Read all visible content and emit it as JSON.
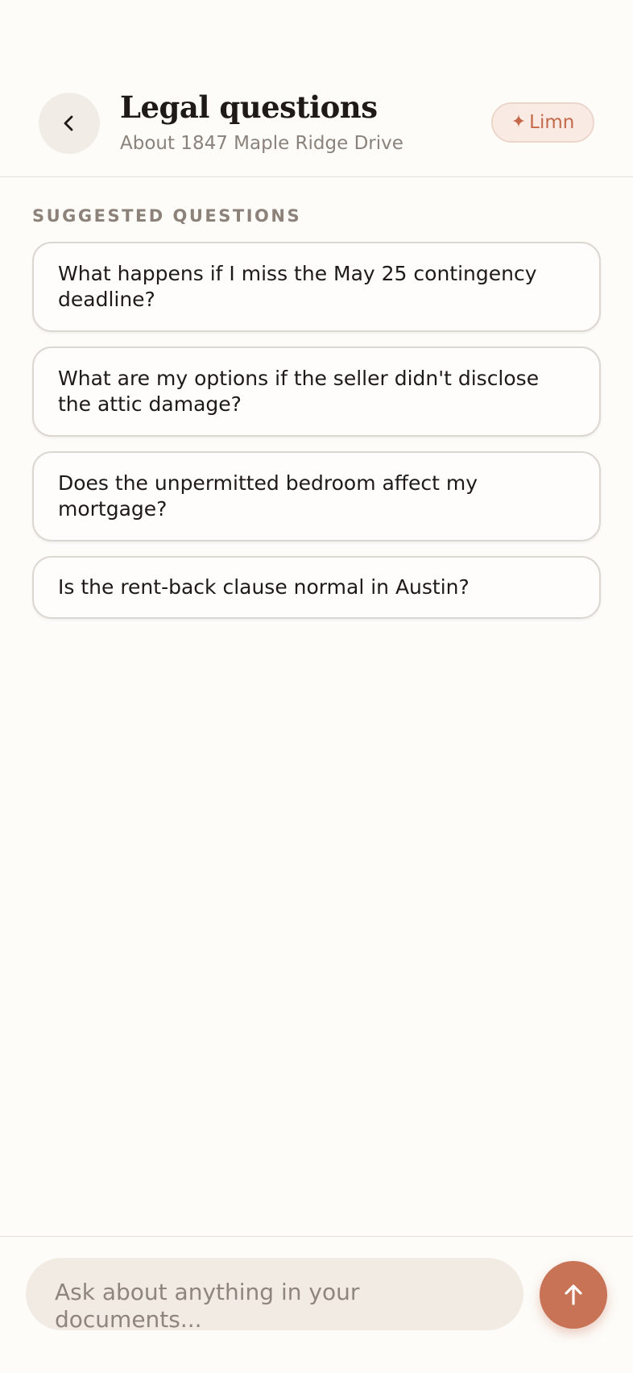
{
  "header": {
    "title": "Legal questions",
    "subtitle": "About 1847 Maple Ridge Drive",
    "back_icon": "chevron-left-icon",
    "badge": {
      "icon": "sparkle-icon",
      "label": "Limn"
    }
  },
  "suggestions": {
    "label": "SUGGESTED QUESTIONS",
    "items": [
      "What happens if I miss the May 25 contingency deadline?",
      "What are my options if the seller didn't disclose the attic damage?",
      "Does the unpermitted bedroom affect my mortgage?",
      "Is the rent-back clause normal in Austin?"
    ]
  },
  "composer": {
    "placeholder": "Ask about anything in your documents...",
    "value": "",
    "send_icon": "arrow-up-icon"
  },
  "colors": {
    "background": "#fdfcf9",
    "accent": "#c87256",
    "badge_bg": "#f9ebe3",
    "input_bg": "#f1ebe4",
    "muted_text": "#8a827b"
  }
}
